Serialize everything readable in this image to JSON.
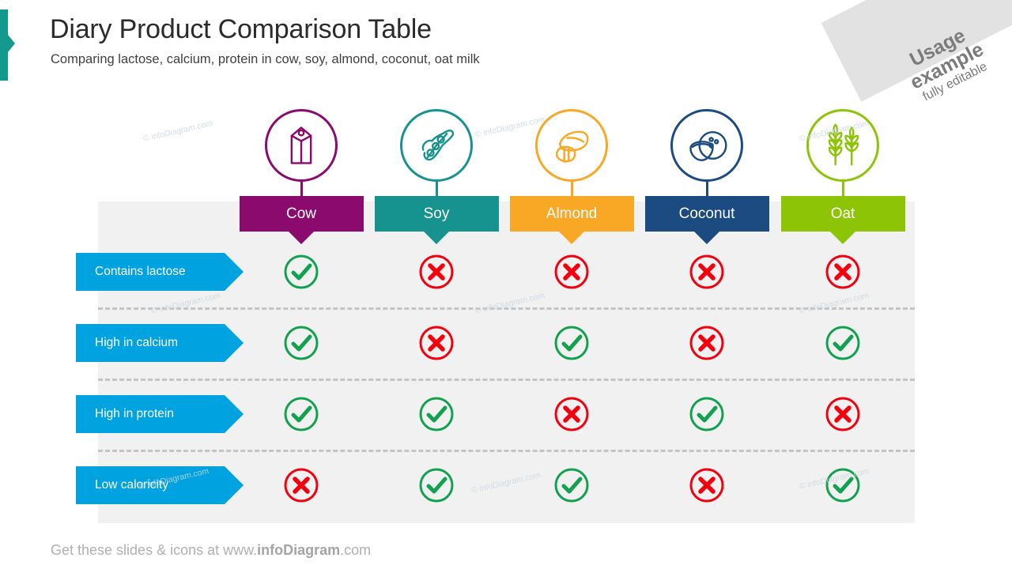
{
  "slide": {
    "title": "Diary Product Comparison Table",
    "subtitle": "Comparing lactose, calcium, protein in cow, soy, almond, coconut, oat milk",
    "footer_prefix": "Get these slides & icons at www.",
    "footer_brand": "infoDiagram",
    "footer_suffix": ".com",
    "accent_color": "#14998e"
  },
  "ribbon": {
    "line1": "Usage",
    "line2": "example",
    "line3": "fully editable",
    "background": "#e2e2e2",
    "text_color": "#7b7b7b"
  },
  "watermark": {
    "text": "© infoDiagram.com",
    "color": "#ccd6e0"
  },
  "columns": [
    {
      "label": "Cow",
      "color": "#8B0A6E",
      "icon": "milk-carton-icon"
    },
    {
      "label": "Soy",
      "color": "#16938E",
      "icon": "soy-pods-icon"
    },
    {
      "label": "Almond",
      "color": "#F9A825",
      "icon": "almond-nuts-icon"
    },
    {
      "label": "Coconut",
      "color": "#1C4B82",
      "icon": "coconut-icon"
    },
    {
      "label": "Oat",
      "color": "#8DC406",
      "icon": "wheat-stalks-icon"
    }
  ],
  "rows": [
    {
      "label": "Contains lactose"
    },
    {
      "label": "High in calcium"
    },
    {
      "label": "High in protein"
    },
    {
      "label": "Low caloricity"
    }
  ],
  "row_label_color": "#00a3e0",
  "marks": {
    "yes_color": "#12a150",
    "no_color": "#f2000e",
    "yes_name": "check-mark-icon",
    "no_name": "cross-mark-icon"
  },
  "chart_data": {
    "type": "table",
    "title": "Diary Product Comparison Table",
    "categories": [
      "Cow",
      "Soy",
      "Almond",
      "Coconut",
      "Oat"
    ],
    "rows": [
      "Contains lactose",
      "High in calcium",
      "High in protein",
      "Low caloricity"
    ],
    "values": [
      [
        "yes",
        "no",
        "no",
        "no",
        "no"
      ],
      [
        "yes",
        "no",
        "yes",
        "no",
        "yes"
      ],
      [
        "yes",
        "yes",
        "no",
        "yes",
        "no"
      ],
      [
        "no",
        "yes",
        "yes",
        "no",
        "yes"
      ]
    ],
    "legend": {
      "yes": "check (green)",
      "no": "cross (red)"
    }
  }
}
